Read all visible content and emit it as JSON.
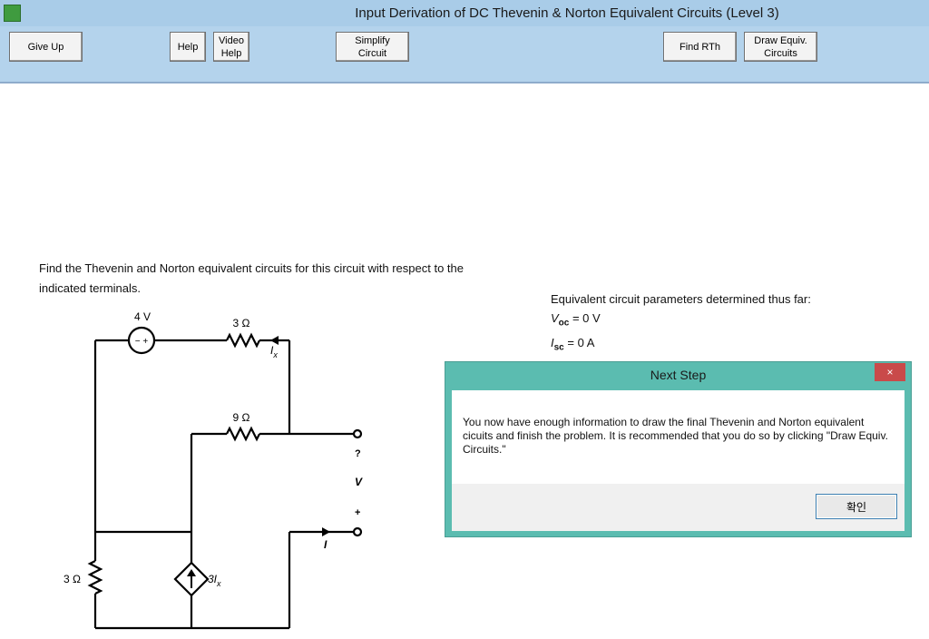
{
  "window": {
    "title": "Input Derivation of DC Thevenin & Norton Equivalent Circuits (Level 3)"
  },
  "toolbar": {
    "give_up": "Give Up",
    "help": "Help",
    "video_help": "Video\nHelp",
    "simplify_circuit": "Simplify\nCircuit",
    "find_rth": "Find RTh",
    "draw_equiv": "Draw Equiv.\nCircuits"
  },
  "problem": {
    "text": "Find the Thevenin and Norton equivalent circuits for this circuit with respect to the indicated terminals."
  },
  "params": {
    "heading": "Equivalent circuit parameters determined thus far:",
    "voc_sym": "V",
    "voc_sub": "oc",
    "voc_val": " = 0 V",
    "isc_sym": "I",
    "isc_sub": "sc",
    "isc_val": " = 0 A"
  },
  "circuit": {
    "source_label": "4 V",
    "r_top": "3 Ω",
    "r_mid": "9 Ω",
    "r_left": "3 Ω",
    "ix_label": "I",
    "ix_sub": "x",
    "dep_label": "3I",
    "dep_sub": "x",
    "v_minus": "?",
    "v_label": "V",
    "v_plus": "+",
    "i_label": "I",
    "source_sign": "− +"
  },
  "dialog": {
    "title": "Next Step",
    "close": "×",
    "message": "You now have enough information to draw the final Thevenin and Norton equivalent cicuits and finish the problem.  It is recommended that you do so by clicking \"Draw Equiv. Circuits.\"",
    "ok": "확인"
  }
}
